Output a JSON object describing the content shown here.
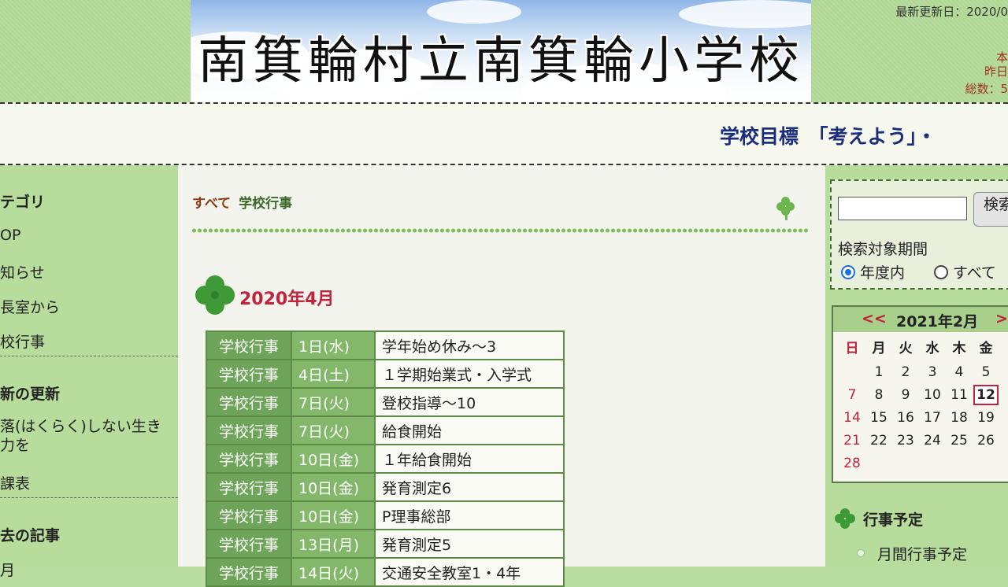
{
  "header": {
    "title": "南箕輪村立南箕輪小学校",
    "updated": "最新更新日：2020/0",
    "counter": {
      "today": "本",
      "yesterday": "昨日",
      "total": "総数：5"
    }
  },
  "motto": "学校目標　「考えよう」・",
  "left_sidebar": {
    "category_title": "テゴリ",
    "categories": [
      "OP",
      "知らせ",
      "長室から",
      "校行事"
    ],
    "latest_title": "新の更新",
    "latest_items": [
      "落(はくらく)しない生き\n力を",
      "課表"
    ],
    "past_title": "去の記事",
    "past_first": "月"
  },
  "main": {
    "breadcrumb": {
      "all": "すべて",
      "category": "学校行事"
    },
    "month_heading": "2020年4月",
    "events": [
      {
        "cat": "学校行事",
        "date": "1日(水)",
        "title": "学年始め休み～3"
      },
      {
        "cat": "学校行事",
        "date": "4日(土)",
        "title": "１学期始業式・入学式"
      },
      {
        "cat": "学校行事",
        "date": "7日(火)",
        "title": "登校指導～10"
      },
      {
        "cat": "学校行事",
        "date": "7日(火)",
        "title": "給食開始"
      },
      {
        "cat": "学校行事",
        "date": "10日(金)",
        "title": "１年給食開始"
      },
      {
        "cat": "学校行事",
        "date": "10日(金)",
        "title": "発育測定6"
      },
      {
        "cat": "学校行事",
        "date": "10日(金)",
        "title": "P理事総部"
      },
      {
        "cat": "学校行事",
        "date": "13日(月)",
        "title": "発育測定5"
      },
      {
        "cat": "学校行事",
        "date": "14日(火)",
        "title": "交通安全教室1・4年"
      }
    ]
  },
  "search": {
    "button": "検索",
    "period_label": "検索対象期間",
    "option_year": "年度内",
    "option_all": "すべて",
    "selected": "年度内"
  },
  "calendar": {
    "prev": "<<",
    "year_month": "2021年2月",
    "next": ">>",
    "weekdays": [
      "日",
      "月",
      "火",
      "水",
      "木",
      "金"
    ],
    "weeks": [
      [
        "",
        "1",
        "2",
        "3",
        "4",
        "5"
      ],
      [
        "7",
        "8",
        "9",
        "10",
        "11",
        "12"
      ],
      [
        "14",
        "15",
        "16",
        "17",
        "18",
        "19"
      ],
      [
        "21",
        "22",
        "23",
        "24",
        "25",
        "26"
      ],
      [
        "28",
        "",
        "",
        "",
        "",
        ""
      ]
    ],
    "today": "12"
  },
  "schedule": {
    "title": "行事予定",
    "item": "月間行事予定"
  },
  "colors": {
    "accent_red": "#c0233b",
    "motto_blue": "#1c2d7c",
    "table_green": "#6fa55a",
    "background_green": "#b7dc9c"
  }
}
